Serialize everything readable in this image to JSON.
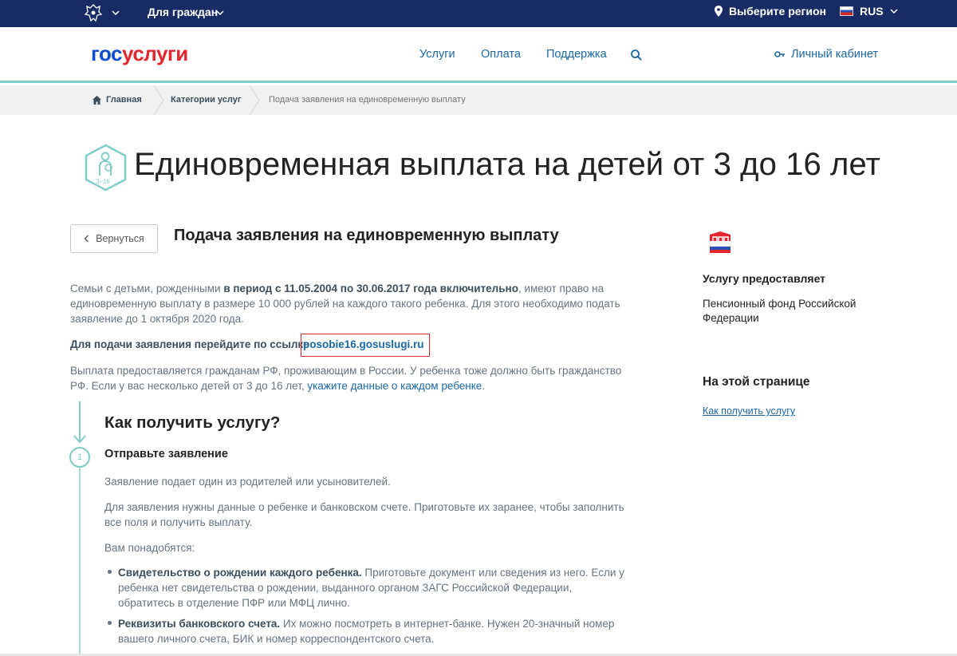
{
  "topbar": {
    "citizens_label": "Для граждан",
    "region_label": "Выберите регион",
    "lang_label": "RUS"
  },
  "header": {
    "logo_part1": "гос",
    "logo_part2": "услуги",
    "nav": [
      "Услуги",
      "Оплата",
      "Поддержка"
    ],
    "account_label": "Личный кабинет"
  },
  "breadcrumbs": {
    "home": "Главная",
    "categories": "Категории услуг",
    "current": "Подача заявления на единовременную выплату"
  },
  "page": {
    "title": "Единовременная выплата на детей от 3 до 16 лет",
    "icon_badge": "3–16",
    "back_label": "Вернуться",
    "subtitle": "Подача заявления на единовременную выплату"
  },
  "intro": {
    "p1_start": "Семьи с детьми, рожденными ",
    "p1_bold": "в период с 11.05.2004 по 30.06.2017 года включительно",
    "p1_end": ", имеют право на единовременную выплату в размере 10 000 рублей на каждого такого ребенка. Для этого необходимо подать заявление до 1 октября 2020 года.",
    "cta_text": "Для подачи заявления перейдите по ссылке",
    "cta_link": "posobie16.gosuslugi.ru",
    "p2_start": "Выплата предоставляется гражданам РФ, проживающим в России. У ребенка тоже должно быть гражданство РФ. Если у вас несколько детей от 3 до 16 лет, ",
    "p2_link": "укажите данные о каждом ребенке",
    "p2_end": "."
  },
  "steps": {
    "heading": "Как получить услугу?",
    "step1_number": "1",
    "step1_title": "Отправьте заявление",
    "s1": "Заявление подает один из родителей или усыновителей.",
    "s2": "Для заявления нужны данные о ребенке и банковском счете. Приготовьте их заранее, чтобы заполнить все поля и получить выплату.",
    "s3": "Вам понадобятся:",
    "b1_bold": "Свидетельство о рождении каждого ребенка.",
    "b1_text": " Приготовьте документ или сведения из него. Если у ребенка нет свидетельства о рождении, выданного органом ЗАГС Российской Федерации, обратитесь в отделение ПФР или МФЦ лично.",
    "b2_bold": "Реквизиты банковского счета.",
    "b2_text": " Их можно посмотреть в интернет-банке. Нужен 20-значный номер вашего личного счета, БИК и номер корреспондентского счета."
  },
  "sidebar": {
    "provider_heading": "Услугу предоставляет",
    "provider_name": "Пенсионный фонд Российской Федерации",
    "onpage_heading": "На этой странице",
    "onpage_link": "Как получить услугу"
  },
  "colors": {
    "topbar": "#192b64",
    "accent_teal": "#7fcdc6",
    "link": "#1a67a7",
    "logo_blue": "#0d4cd3",
    "logo_red": "#e3262e"
  }
}
